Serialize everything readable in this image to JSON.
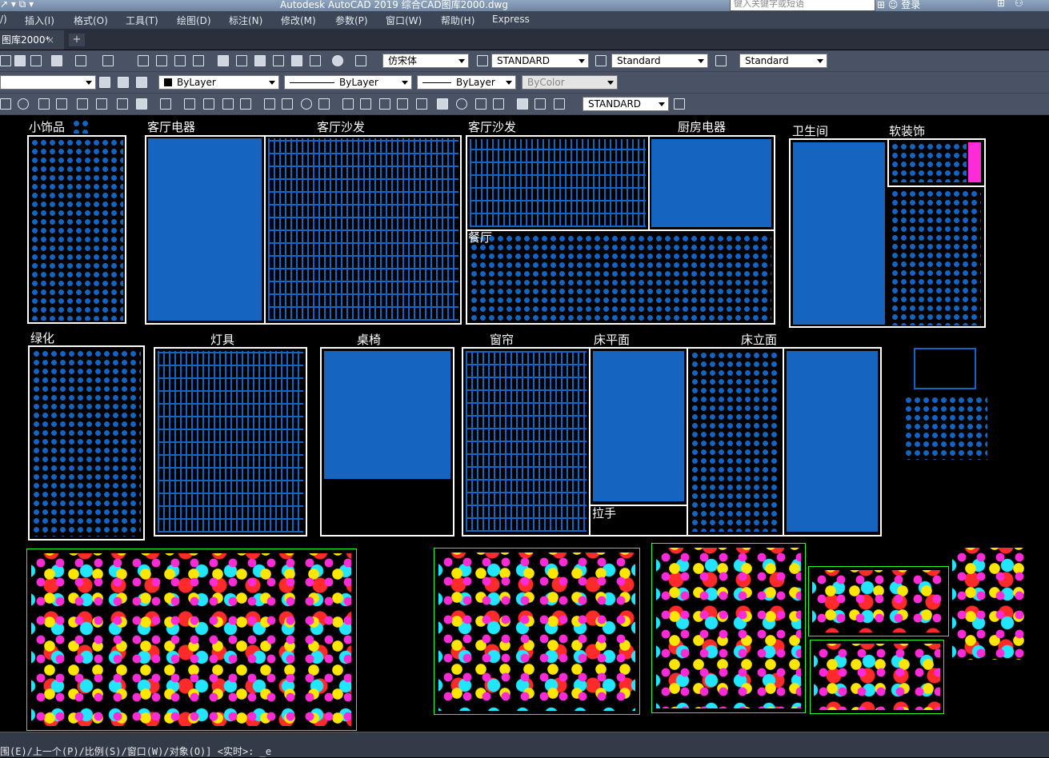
{
  "title_bar": {
    "title": "Autodesk AutoCAD 2019    综合CAD图库2000.dwg",
    "search_placeholder": "键入关键字或短语",
    "sign_in": "登录"
  },
  "menu": [
    "插入(I)",
    "格式(O)",
    "工具(T)",
    "绘图(D)",
    "标注(N)",
    "修改(M)",
    "参数(P)",
    "窗口(W)",
    "帮助(H)",
    "Express"
  ],
  "menu_partial_first": "/)",
  "tab": {
    "label": "图库2000*",
    "add": "+"
  },
  "toolbar": {
    "text_font": "仿宋体",
    "dim_style": "STANDARD",
    "table_style": "Standard",
    "multileader_style": "Standard",
    "layer": "",
    "color": "ByLayer",
    "linetype": "ByLayer",
    "lineweight": "ByLayer",
    "plotstyle": "ByColor",
    "dim_style2": "STANDARD"
  },
  "drawing": {
    "labels": {
      "decor": "小饰品",
      "appliances": "客厅电器",
      "sofa1": "客厅沙发",
      "sofa2": "客厅沙发",
      "kitchen": "厨房电器",
      "dining": "餐厅",
      "bathroom": "卫生间",
      "soft": "软装饰",
      "plants": "绿化",
      "lamps": "灯具",
      "tables_chairs": "桌椅",
      "curtains": "窗帘",
      "bed_plan": "床平面",
      "bed_elev": "床立面",
      "handle": "拉手"
    },
    "colors": {
      "block_blue": "#1565c0",
      "frame_white": "#ffffff",
      "frame_green": "#22ff22"
    }
  },
  "command_line": {
    "text": "围(E)/上一个(P)/比例(S)/窗口(W)/对象(O)] <实时>: _e"
  }
}
